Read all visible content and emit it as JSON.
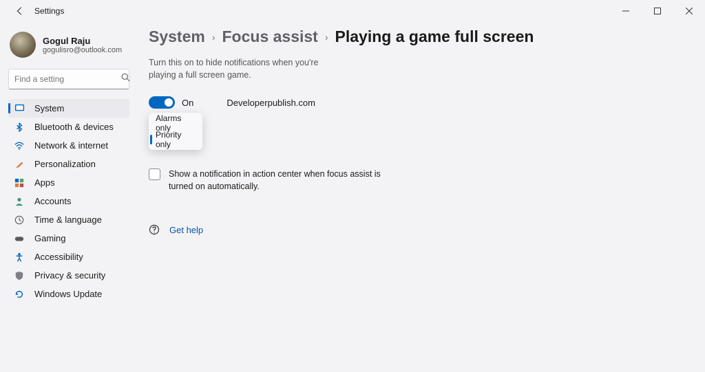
{
  "window": {
    "title": "Settings"
  },
  "profile": {
    "name": "Gogul Raju",
    "email": "gogulisro@outlook.com"
  },
  "search": {
    "placeholder": "Find a setting"
  },
  "nav": {
    "items": [
      {
        "label": "System"
      },
      {
        "label": "Bluetooth & devices"
      },
      {
        "label": "Network & internet"
      },
      {
        "label": "Personalization"
      },
      {
        "label": "Apps"
      },
      {
        "label": "Accounts"
      },
      {
        "label": "Time & language"
      },
      {
        "label": "Gaming"
      },
      {
        "label": "Accessibility"
      },
      {
        "label": "Privacy & security"
      },
      {
        "label": "Windows Update"
      }
    ]
  },
  "breadcrumbs": {
    "a": "System",
    "b": "Focus assist",
    "c": "Playing a game full screen"
  },
  "description": "Turn this on to hide notifications when you're playing a full screen game.",
  "toggle": {
    "state_label": "On"
  },
  "watermark": "Developerpublish.com",
  "dropdown": {
    "items": [
      {
        "label": "Alarms only"
      },
      {
        "label": "Priority only"
      }
    ]
  },
  "checkbox": {
    "label": "Show a notification in action center when focus assist is turned on automatically."
  },
  "help": {
    "label": "Get help"
  }
}
